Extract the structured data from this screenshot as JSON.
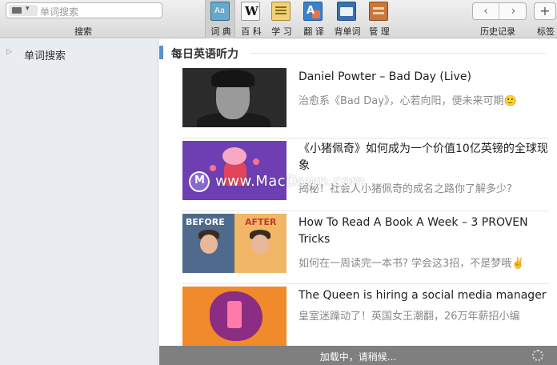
{
  "toolbar": {
    "search_placeholder": "单词搜索",
    "search_label": "搜索",
    "tools": [
      {
        "label": "词 典",
        "icon": "dictionary-icon",
        "active": true
      },
      {
        "label": "百 科",
        "icon": "wikipedia-icon",
        "active": false
      },
      {
        "label": "学 习",
        "icon": "study-icon",
        "active": false
      },
      {
        "label": "翻 译",
        "icon": "translate-icon",
        "active": false
      },
      {
        "label": "背单词",
        "icon": "vocabulary-icon",
        "active": false
      },
      {
        "label": "管 理",
        "icon": "manage-icon",
        "active": false
      }
    ],
    "history_label": "历史记录",
    "bookmark_label": "标签",
    "back_glyph": "‹",
    "forward_glyph": "›",
    "add_glyph": "+"
  },
  "sidebar": {
    "items": [
      {
        "label": "单词搜索",
        "expand_glyph": "▷"
      }
    ]
  },
  "main": {
    "section_title": "每日英语听力",
    "articles": [
      {
        "title": "Daniel Powter – Bad Day (Live)",
        "subtitle": "治愈系《Bad Day》，心若向阳，便未来可期🙂"
      },
      {
        "title": "《小猪佩奇》如何成为一个价值10亿英镑的全球现象",
        "subtitle": "揭秘！社会人小猪佩奇的成名之路你了解多少?"
      },
      {
        "title": "How To Read A Book A Week – 3 PROVEN Tricks",
        "subtitle": "如何在一周读完一本书? 学会这3招，不是梦哦✌️"
      },
      {
        "title": "The Queen is hiring a social media manager",
        "subtitle": "皇室迷躁动了！英国女王潮翻，26万年薪招小编"
      }
    ],
    "thumb_tags": {
      "before": "BEFORE",
      "after": "AFTER"
    }
  },
  "watermark": {
    "text": "www.MacDown.com"
  },
  "status": {
    "text": "加载中，请稍候..."
  },
  "colors": {
    "accent": "#5b8fd1",
    "status_bar": "#7f7f7f",
    "sidebar_bg": "#e9ecf0"
  }
}
